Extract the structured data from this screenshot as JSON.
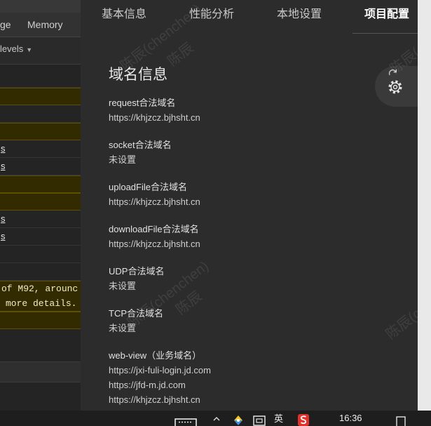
{
  "colors": {
    "console_bg": "#242424",
    "panel_bg": "#2c2c2c",
    "warning_bg": "#332b00",
    "warning_border": "#5e5000",
    "active_tab": "#ffffff"
  },
  "devtools": {
    "tabs": [
      {
        "label": "ge"
      },
      {
        "label": "Memory"
      }
    ],
    "levels_label": "levels",
    "levels_caret": "▼",
    "link_rows": [
      "s",
      "s",
      "s",
      "s"
    ],
    "warning_message": [
      "of M92, arounc",
      "more details."
    ]
  },
  "project_panel": {
    "tabs": [
      {
        "label": "基本信息",
        "active": false
      },
      {
        "label": "性能分析",
        "active": false
      },
      {
        "label": "本地设置",
        "active": false
      },
      {
        "label": "项目配置",
        "active": true
      }
    ],
    "section_title": "域名信息",
    "domains": [
      {
        "label": "request合法域名",
        "values": [
          "https://khjzcz.bjhsht.cn"
        ]
      },
      {
        "label": "socket合法域名",
        "values": [
          "未设置"
        ]
      },
      {
        "label": "uploadFile合法域名",
        "values": [
          "https://khjzcz.bjhsht.cn"
        ]
      },
      {
        "label": "downloadFile合法域名",
        "values": [
          "https://khjzcz.bjhsht.cn"
        ]
      },
      {
        "label": "UDP合法域名",
        "values": [
          "未设置"
        ]
      },
      {
        "label": "TCP合法域名",
        "values": [
          "未设置"
        ]
      },
      {
        "label": "web-view（业务域名）",
        "values": [
          "https://jxi-fuli-login.jd.com",
          "https://jfd-m.jd.com",
          "https://khjzcz.bjhsht.cn"
        ]
      }
    ],
    "settings_button_icons": [
      "refresh-icon",
      "gear-icon"
    ]
  },
  "watermarks": [
    "陈辰(chenchen)",
    "陈辰",
    "陈辰(chenchen)",
    "陈辰",
    "陈辰(c",
    "陈辰(c"
  ],
  "taskbar": {
    "icons": [
      "keyboard-icon",
      "chevron-up-icon",
      "app-icon",
      "display-icon",
      "wps-icon",
      "notification-icon"
    ],
    "ime_label": "英",
    "time": "16:36"
  }
}
